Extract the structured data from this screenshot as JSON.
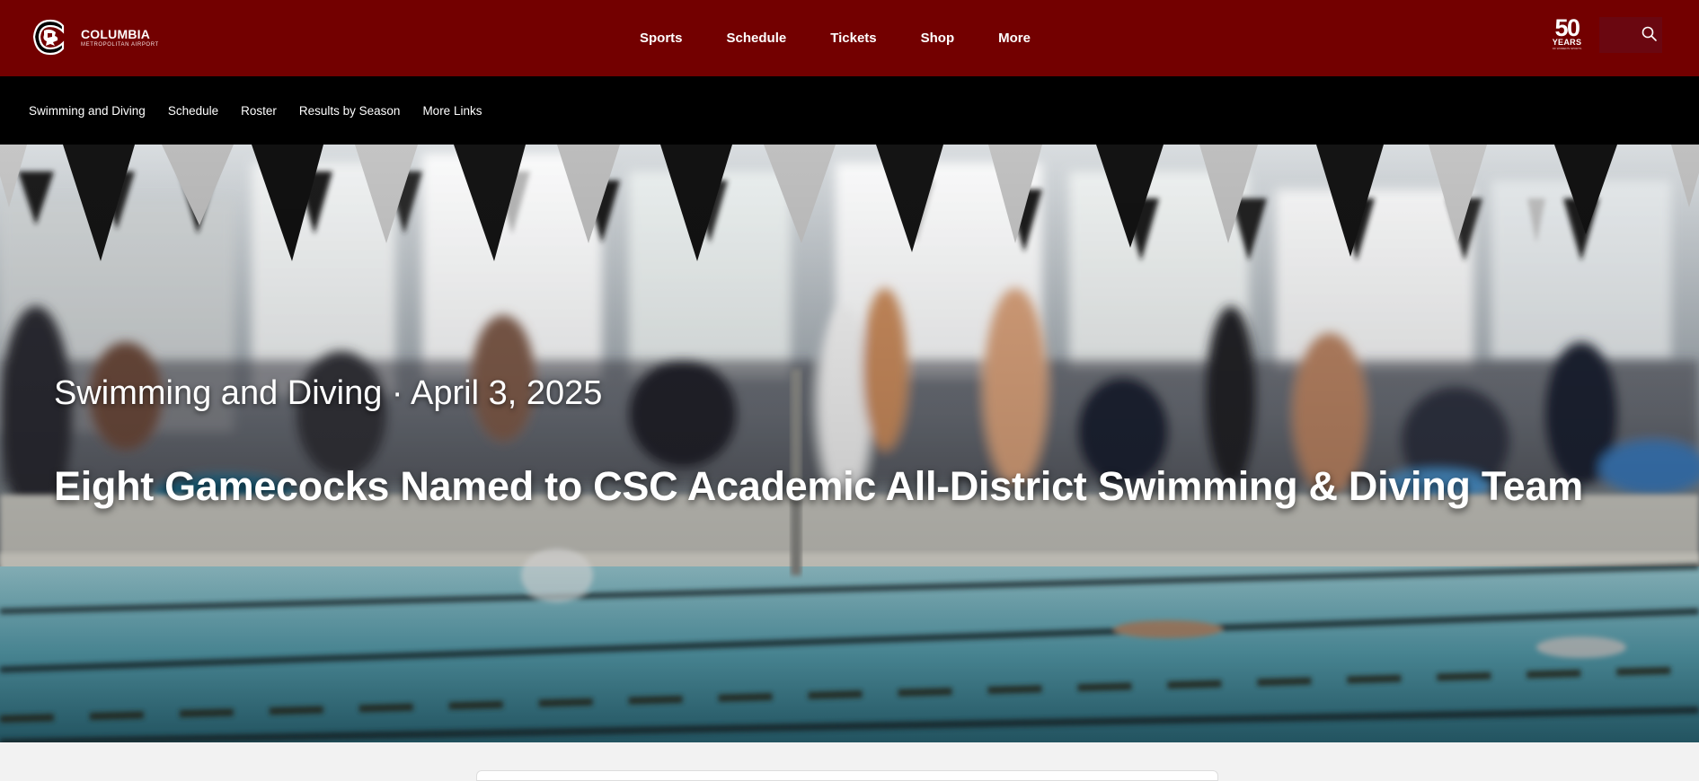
{
  "brand": {
    "primary_color": "#730000",
    "subnav_color": "#000000",
    "logo_icon": "gamecock-logo-icon"
  },
  "sponsor": {
    "name": "COLUMBIA",
    "sub": "METROPOLITAN AIRPORT"
  },
  "main_nav": {
    "items": [
      "Sports",
      "Schedule",
      "Tickets",
      "Shop",
      "More"
    ]
  },
  "badge_50": {
    "number": "50",
    "word": "YEARS",
    "tagline": "OF WOMEN'S SPORTS"
  },
  "search": {
    "icon": "search-icon"
  },
  "sub_nav": {
    "items": [
      "Swimming and Diving",
      "Schedule",
      "Roster",
      "Results by Season",
      "More Links"
    ]
  },
  "hero": {
    "meta": "Swimming and Diving · April 3, 2025",
    "title": "Eight Gamecocks Named to CSC Academic All-District Swimming & Diving Team"
  }
}
